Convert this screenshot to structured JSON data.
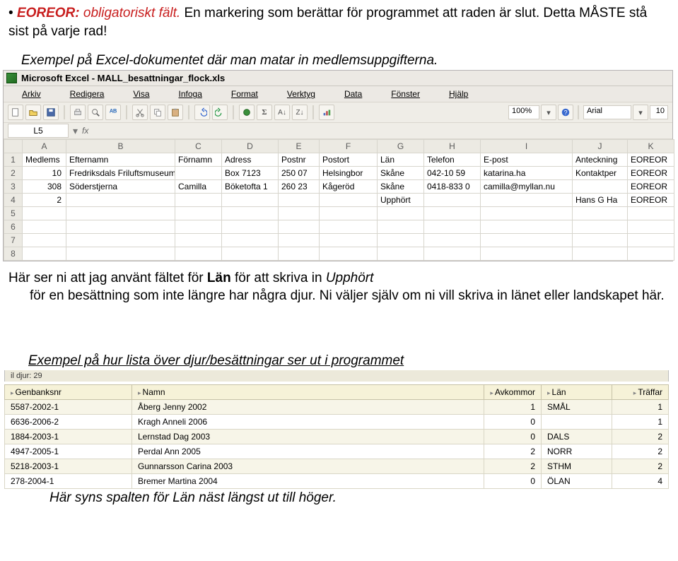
{
  "bullet": {
    "term": "EOREOR:",
    "term_trailing": "obligatoriskt fält.",
    "rest": " En markering som berättar för programmet att raden är slut. Detta MÅSTE stå sist på varje rad!"
  },
  "caption_excel": "Exempel på Excel-dokumentet där man matar in medlemsuppgifterna.",
  "excel": {
    "app_title": "Microsoft Excel - MALL_besattningar_flock.xls",
    "menu": [
      "Arkiv",
      "Redigera",
      "Visa",
      "Infoga",
      "Format",
      "Verktyg",
      "Data",
      "Fönster",
      "Hjälp"
    ],
    "zoom": "100%",
    "font_name": "Arial",
    "font_size": "10",
    "name_box": "L5",
    "fx_label": "fx",
    "col_headers": [
      "A",
      "B",
      "C",
      "D",
      "E",
      "F",
      "G",
      "H",
      "I",
      "J",
      "K"
    ],
    "rows": [
      {
        "n": "1",
        "cells": [
          "Medlems",
          "Efternamn",
          "Förnamn",
          "Adress",
          "Postnr",
          "Postort",
          "Län",
          "Telefon",
          "E-post",
          "Anteckning",
          "EOREOR"
        ]
      },
      {
        "n": "2",
        "cells": [
          "10",
          "Fredriksdals Friluftsmuseum",
          "",
          "Box 7123",
          "250 07",
          "Helsingbor",
          "Skåne",
          "042-10 59",
          "katarina.ha",
          "Kontaktper",
          "EOREOR"
        ]
      },
      {
        "n": "3",
        "cells": [
          "308",
          "Söderstjerna",
          "Camilla",
          "Böketofta 1",
          "260 23",
          "Kågeröd",
          "Skåne",
          "0418-833 0",
          "camilla@myllan.nu",
          "",
          "EOREOR"
        ]
      },
      {
        "n": "4",
        "cells": [
          "2",
          "",
          "",
          "",
          "",
          "",
          "Upphört",
          "",
          "",
          "Hans G Ha",
          "EOREOR"
        ]
      },
      {
        "n": "5",
        "cells": [
          "",
          "",
          "",
          "",
          "",
          "",
          "",
          "",
          "",
          "",
          ""
        ]
      },
      {
        "n": "6",
        "cells": [
          "",
          "",
          "",
          "",
          "",
          "",
          "",
          "",
          "",
          "",
          ""
        ]
      },
      {
        "n": "7",
        "cells": [
          "",
          "",
          "",
          "",
          "",
          "",
          "",
          "",
          "",
          "",
          ""
        ]
      },
      {
        "n": "8",
        "cells": [
          "",
          "",
          "",
          "",
          "",
          "",
          "",
          "",
          "",
          "",
          ""
        ]
      }
    ]
  },
  "mid_p1_a": "Här ser ni att jag använt fältet för ",
  "mid_p1_b": "Län",
  "mid_p1_c": " för att skriva in ",
  "mid_p1_d": "Upphört",
  "mid_p1_e": " för en besättning som inte längre har några djur. Ni väljer själv om ni vill skriva in länet eller landskapet här.",
  "caption_prog": "Exempel på hur lista över djur/besättningar ser ut i programmet",
  "prog_header_extra": "il djur: 29",
  "prog": {
    "headers": [
      "Genbanksnr",
      "Namn",
      "Avkommor",
      "Län",
      "Träffar"
    ],
    "rows": [
      {
        "g": "5587-2002-1",
        "n": "Åberg Jenny 2002",
        "a": "1",
        "l": "SMÅL",
        "t": "1",
        "zeb": true
      },
      {
        "g": "6636-2006-2",
        "n": "Kragh Anneli 2006",
        "a": "0",
        "l": "",
        "t": "1",
        "zeb": false
      },
      {
        "g": "1884-2003-1",
        "n": "Lernstad Dag 2003",
        "a": "0",
        "l": "DALS",
        "t": "2",
        "zeb": true
      },
      {
        "g": "4947-2005-1",
        "n": "Perdal Ann 2005",
        "a": "2",
        "l": "NORR",
        "t": "2",
        "zeb": false
      },
      {
        "g": "5218-2003-1",
        "n": "Gunnarsson Carina 2003",
        "a": "2",
        "l": "STHM",
        "t": "2",
        "zeb": true
      },
      {
        "g": "278-2004-1",
        "n": "Bremer Martina 2004",
        "a": "0",
        "l": "ÖLAN",
        "t": "4",
        "zeb": false
      }
    ]
  },
  "caption_bottom": "Här syns spalten för Län näst längst ut till höger."
}
